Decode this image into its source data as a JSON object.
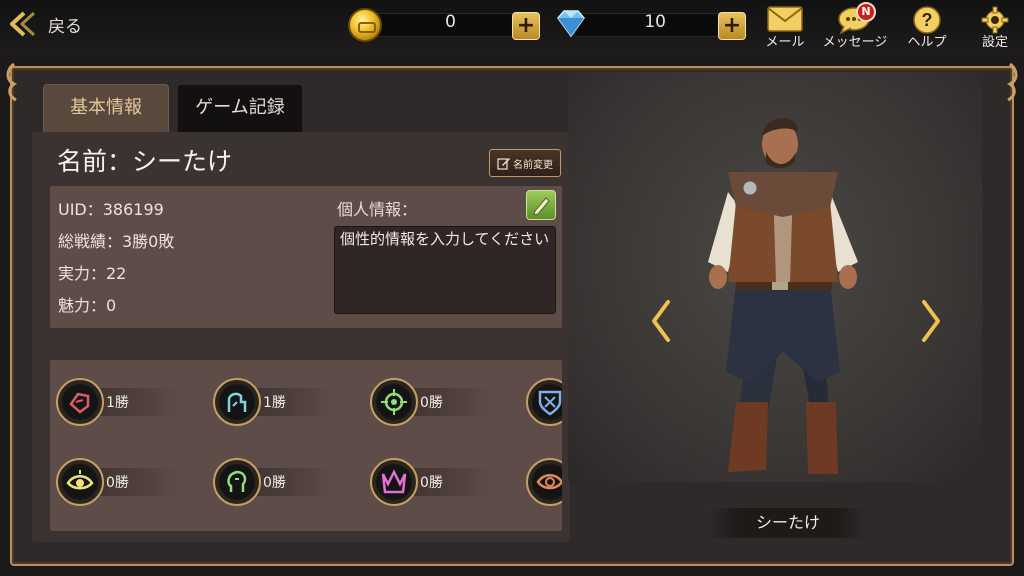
{
  "header": {
    "back_label": "戻る",
    "gold": "0",
    "gems": "10",
    "mail_label": "メール",
    "message_label": "メッセージ",
    "message_badge": "N",
    "help_label": "ヘルプ",
    "settings_label": "設定"
  },
  "tabs": [
    {
      "label": "基本情報",
      "active": true
    },
    {
      "label": "ゲーム記録",
      "active": false
    }
  ],
  "profile": {
    "name_line": "名前：シーたけ",
    "rename_label": "名前変更",
    "uid": "UID：386199",
    "record": "総戦績：3勝0敗",
    "power": "実力：22",
    "charm": "魅力：0",
    "personal_info_label": "個人情報：",
    "personal_info_text": "個性的情報を入力してください"
  },
  "achievements": [
    {
      "icon": "fist-emblem-icon",
      "wins": "1勝",
      "color": "#e05a6a"
    },
    {
      "icon": "healer-emblem-icon",
      "wins": "1勝",
      "color": "#7fd6e0"
    },
    {
      "icon": "crosshair-emblem-icon",
      "wins": "0勝",
      "color": "#8fe07a"
    },
    {
      "icon": "shield-emblem-icon",
      "wins": "",
      "color": "#7fb0e8"
    },
    {
      "icon": "eye-emblem-icon",
      "wins": "0勝",
      "color": "#f0e37a"
    },
    {
      "icon": "head-emblem-icon",
      "wins": "0勝",
      "color": "#8fe07a"
    },
    {
      "icon": "crown-emblem-icon",
      "wins": "0勝",
      "color": "#e56fd6"
    },
    {
      "icon": "eye-swirl-emblem-icon",
      "wins": "",
      "color": "#e08a5a"
    }
  ],
  "character": {
    "name": "シーたけ"
  }
}
